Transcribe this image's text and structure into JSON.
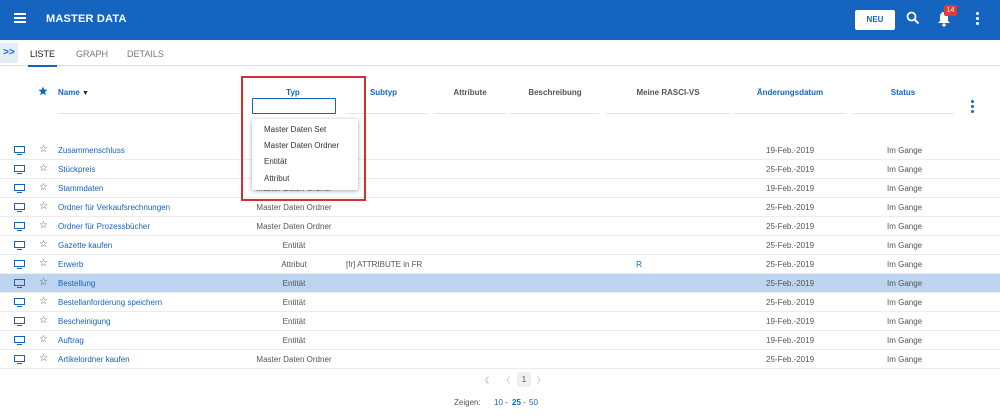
{
  "header": {
    "title": "MASTER DATA",
    "new_button": "NEU",
    "notification_count": "14",
    "icons": [
      "menu-icon",
      "search-icon",
      "bell-icon",
      "kebab-menu-icon"
    ]
  },
  "tabs": [
    {
      "label": "LISTE",
      "active": true
    },
    {
      "label": "GRAPH",
      "active": false
    },
    {
      "label": "DETAILS",
      "active": false
    }
  ],
  "columns": {
    "name": "Name",
    "typ": "Typ",
    "subtyp": "Subtyp",
    "attribute": "Attribute",
    "beschreibung": "Beschreibung",
    "rasci": "Meine RASCI-VS",
    "date": "Änderungsdatum",
    "status": "Status"
  },
  "typ_dropdown": {
    "options": [
      "Master Daten Set",
      "Master Daten Ordner",
      "Entität",
      "Attribut"
    ]
  },
  "rows": [
    {
      "name": "Zusammenschluss",
      "typ": "",
      "subtyp": "",
      "rasci": "",
      "date": "19-Feb.-2019",
      "status": "Im Gange"
    },
    {
      "name": "Stückpreis",
      "typ": "",
      "subtyp": "",
      "rasci": "",
      "date": "25-Feb.-2019",
      "status": "Im Gange"
    },
    {
      "name": "Stammdaten",
      "typ": "Master Daten Ordner",
      "subtyp": "",
      "rasci": "",
      "date": "19-Feb.-2019",
      "status": "Im Gange"
    },
    {
      "name": "Ordner für Verkaufsrechnungen",
      "typ": "Master Daten Ordner",
      "subtyp": "",
      "rasci": "",
      "date": "25-Feb.-2019",
      "status": "Im Gange"
    },
    {
      "name": "Ordner für Prozessbücher",
      "typ": "Master Daten Ordner",
      "subtyp": "",
      "rasci": "",
      "date": "25-Feb.-2019",
      "status": "Im Gange"
    },
    {
      "name": "Gazette kaufen",
      "typ": "Entität",
      "subtyp": "",
      "rasci": "",
      "date": "25-Feb.-2019",
      "status": "Im Gange"
    },
    {
      "name": "Erwerb",
      "typ": "Attribut",
      "subtyp": "[fr] ATTRIBUTE in FR",
      "rasci": "R",
      "date": "25-Feb.-2019",
      "status": "Im Gange"
    },
    {
      "name": "Bestellung",
      "typ": "Entität",
      "subtyp": "",
      "rasci": "",
      "date": "25-Feb.-2019",
      "status": "Im Gange"
    },
    {
      "name": "Bestellanforderung speichern",
      "typ": "Entität",
      "subtyp": "",
      "rasci": "",
      "date": "25-Feb.-2019",
      "status": "Im Gange"
    },
    {
      "name": "Bescheinigung",
      "typ": "Entität",
      "subtyp": "",
      "rasci": "",
      "date": "19-Feb.-2019",
      "status": "Im Gange"
    },
    {
      "name": "Auftrag",
      "typ": "Entität",
      "subtyp": "",
      "rasci": "",
      "date": "19-Feb.-2019",
      "status": "Im Gange"
    },
    {
      "name": "Artikelordner kaufen",
      "typ": "Master Daten Ordner",
      "subtyp": "",
      "rasci": "",
      "date": "25-Feb.-2019",
      "status": "Im Gange"
    }
  ],
  "selected_row": 7,
  "pagination": {
    "first": "《",
    "prev": "〈",
    "current": "1",
    "next": "〉"
  },
  "page_size": {
    "label": "Zeigen:",
    "options": [
      "10",
      "25",
      "50"
    ],
    "selected": "25",
    "separators": [
      "-",
      "-"
    ]
  },
  "colors": {
    "primary": "#1565c0",
    "selected_row": "#bcd4ef",
    "highlight": "#d32f2f",
    "badge": "#e53935"
  }
}
